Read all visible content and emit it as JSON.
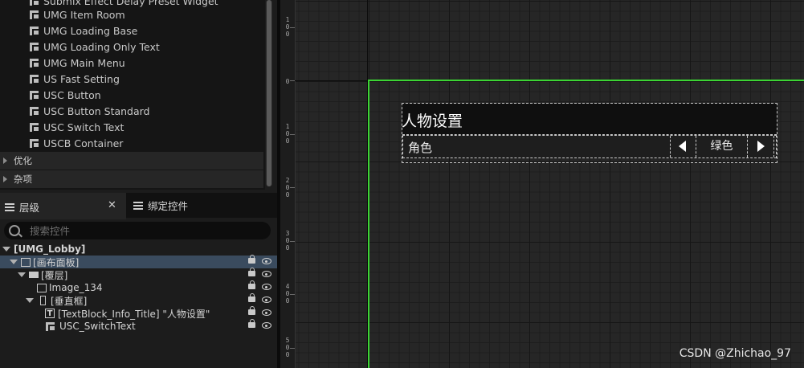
{
  "palette": {
    "items": [
      "Submix Effect Delay Preset Widget",
      "UMG Item Room",
      "UMG Loading Base",
      "UMG Loading Only Text",
      "UMG Main Menu",
      "US Fast Setting",
      "USC Button",
      "USC Button Standard",
      "USC Switch Text",
      "USCB Container"
    ],
    "categories": [
      "优化",
      "杂项"
    ]
  },
  "tabs": {
    "layers": "层级",
    "bind": "绑定控件"
  },
  "search": {
    "placeholder": "搜索控件"
  },
  "hierarchy": {
    "root": "[UMG_Lobby]",
    "canvas_panel": "[画布面板]",
    "overlay": "[覆层]",
    "image": "Image_134",
    "vertical_box": "[垂直框]",
    "title_block": "[TextBlock_Info_Title] \"人物设置\"",
    "switch_text": "USC_SwitchText"
  },
  "ruler": {
    "labels": [
      "1\n0\n0",
      "0",
      "1\n0\n0",
      "2\n0\n0",
      "3\n0\n0",
      "4\n0\n0",
      "5\n0\n0"
    ]
  },
  "preview": {
    "title": "人物设置",
    "switch_label": "角色",
    "switch_value": "绿色"
  },
  "colors": {
    "screen_border": "#3cd434",
    "selection": "#3a4b5e"
  },
  "watermark": "CSDN @Zhichao_97"
}
